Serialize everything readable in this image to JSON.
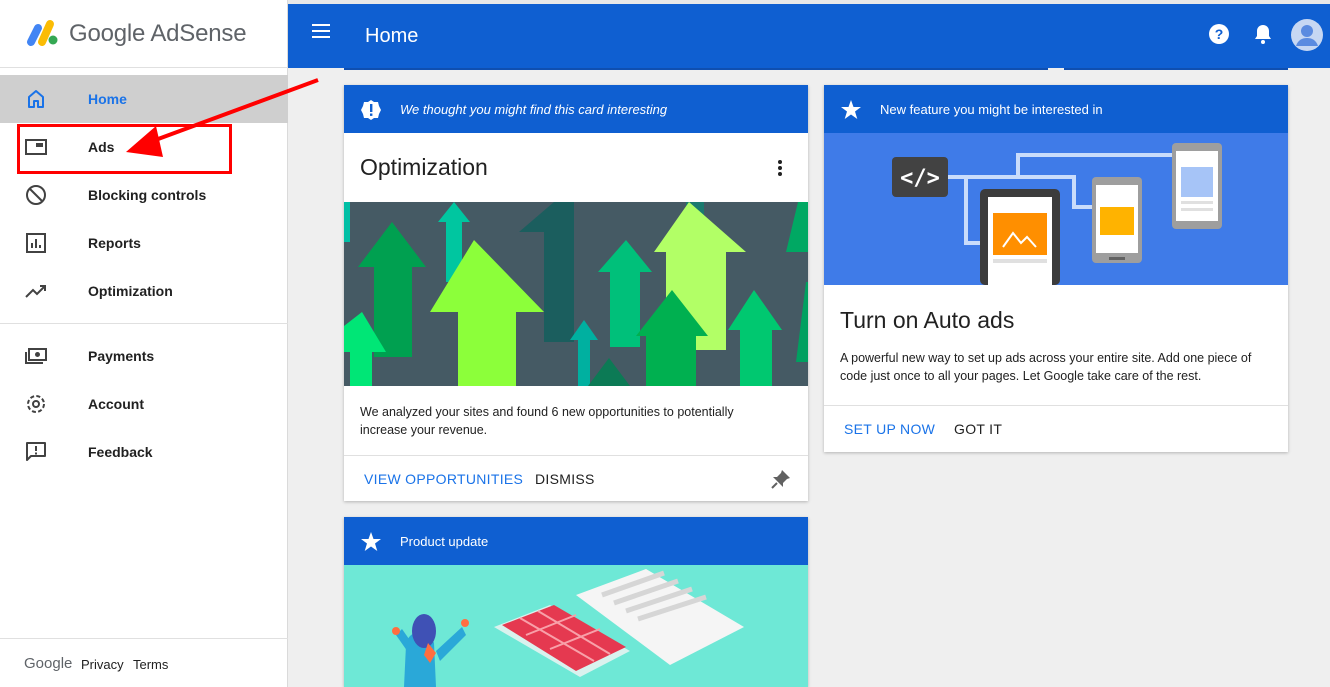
{
  "brand": {
    "name": "Google AdSense"
  },
  "topbar": {
    "title": "Home",
    "help_icon": "help-icon",
    "bell_icon": "notifications-icon",
    "avatar_icon": "account-avatar"
  },
  "sidebar": {
    "items": [
      {
        "label": "Home",
        "icon": "home-icon",
        "active": true
      },
      {
        "label": "Ads",
        "icon": "ads-icon",
        "active": false
      },
      {
        "label": "Blocking controls",
        "icon": "block-icon",
        "active": false
      },
      {
        "label": "Reports",
        "icon": "reports-icon",
        "active": false
      },
      {
        "label": "Optimization",
        "icon": "trending-icon",
        "active": false
      },
      {
        "label": "Payments",
        "icon": "payments-icon",
        "active": false
      },
      {
        "label": "Account",
        "icon": "gear-icon",
        "active": false
      },
      {
        "label": "Feedback",
        "icon": "feedback-icon",
        "active": false
      }
    ],
    "footer": {
      "google": "Google",
      "privacy": "Privacy",
      "terms": "Terms"
    }
  },
  "cards": {
    "optimization": {
      "header": "We thought you might find this card interesting",
      "title": "Optimization",
      "body": "We analyzed your sites and found 6 new opportunities to potentially increase your revenue.",
      "primary_action": "VIEW OPPORTUNITIES",
      "secondary_action": "DISMISS"
    },
    "auto_ads": {
      "header": "New feature you might be interested in",
      "title": "Turn on Auto ads",
      "body": "A powerful new way to set up ads across your entire site. Add one piece of code just once to all your pages. Let Google take care of the rest.",
      "primary_action": "SET UP NOW",
      "secondary_action": "GOT IT"
    },
    "product_update": {
      "header": "Product update"
    }
  },
  "colors": {
    "brand_blue": "#0f5fd1",
    "link_blue": "#1a73e8",
    "annotation_red": "#ff0000"
  }
}
